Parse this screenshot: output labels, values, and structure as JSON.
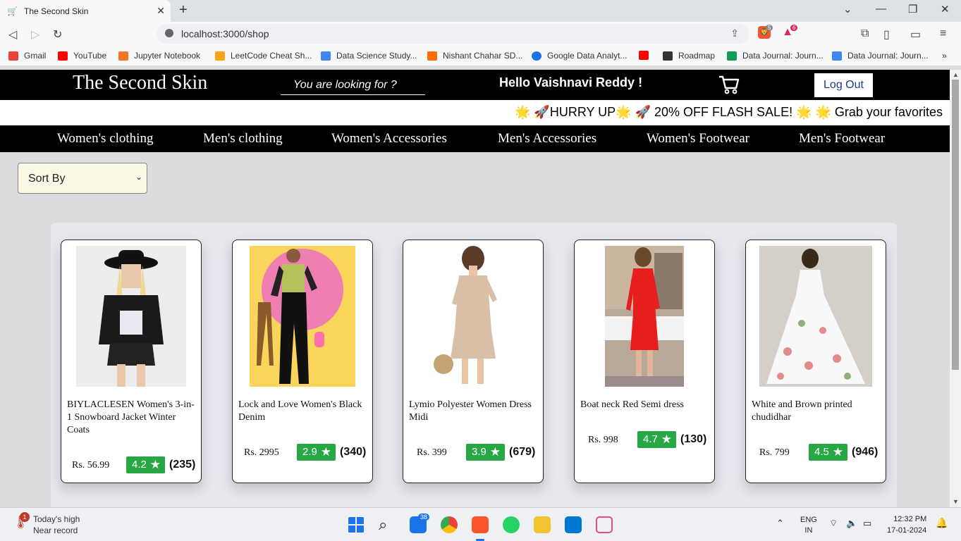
{
  "browser": {
    "tab_title": "The Second Skin",
    "url": "localhost:3000/shop",
    "ext_badges": [
      "5",
      "6"
    ],
    "bookmarks": [
      {
        "label": "Gmail",
        "color": "#ea4335"
      },
      {
        "label": "YouTube",
        "color": "#ff0000"
      },
      {
        "label": "Jupyter Notebook",
        "color": "#f37626"
      },
      {
        "label": "LeetCode Cheat Sh...",
        "color": "#ffa116"
      },
      {
        "label": "Data Science Study...",
        "color": "#4285f4"
      },
      {
        "label": "Nishant Chahar SD...",
        "color": "#ff6d00"
      },
      {
        "label": "Google Data Analyt...",
        "color": "#1a73e8"
      },
      {
        "label": "",
        "color": "#ff0000"
      },
      {
        "label": "Roadmap",
        "color": "#333333"
      },
      {
        "label": "Data Journal: Journ...",
        "color": "#0f9d58"
      },
      {
        "label": "Data Journal: Journ...",
        "color": "#4285f4"
      }
    ]
  },
  "header": {
    "brand": "The Second Skin",
    "search_placeholder": "You are looking for ?",
    "greeting": "Hello Vaishnavi Reddy !",
    "logout_label": "Log Out"
  },
  "ticker": "🌟 🚀HURRY UP🌟 🚀 20% OFF FLASH SALE! 🌟 🌟 Grab your favorites",
  "categories": [
    "Women's clothing",
    "Men's clothing",
    "Women's Accessories",
    "Men's Accessories",
    "Women's Footwear",
    "Men's Footwear"
  ],
  "sort": {
    "selected": "Sort By"
  },
  "products": [
    {
      "name": "BIYLACLESEN Women's 3-in-1 Snowboard Jacket Winter Coats",
      "price": "Rs. 56.99",
      "rating": "4.2",
      "count": "(235)"
    },
    {
      "name": "Lock and Love Women's Black Denim",
      "price": "Rs. 2995",
      "rating": "2.9",
      "count": "(340)"
    },
    {
      "name": "Lymio Polyester Women Dress Midi",
      "price": "Rs. 399",
      "rating": "3.9",
      "count": "(679)"
    },
    {
      "name": "Boat neck Red Semi dress",
      "price": "Rs. 998",
      "rating": "4.7",
      "count": "(130)"
    },
    {
      "name": "White and Brown printed chudidhar",
      "price": "Rs. 799",
      "rating": "4.5",
      "count": "(946)"
    }
  ],
  "taskbar": {
    "weather_title": "Today's high",
    "weather_sub": "Near record",
    "weather_badge": "1",
    "mail_badge": "38",
    "lang": "ENG",
    "region": "IN",
    "time": "12:32 PM",
    "date": "17-01-2024"
  },
  "colors": {
    "rating_green": "#28a745",
    "header_bg": "#000000",
    "sort_bg": "#fbf9e6"
  }
}
